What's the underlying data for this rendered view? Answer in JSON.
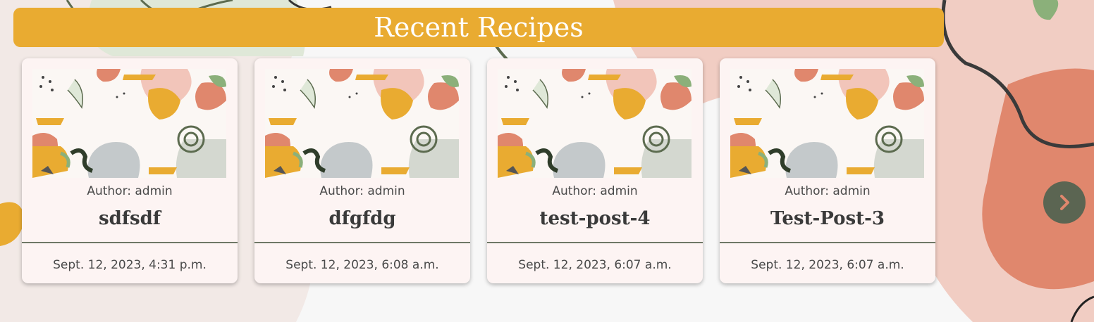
{
  "section": {
    "title": "Recent Recipes"
  },
  "recipes": [
    {
      "author": "Author: admin",
      "title": "sdfsdf",
      "date": "Sept. 12, 2023, 4:31 p.m."
    },
    {
      "author": "Author: admin",
      "title": "dfgfdg",
      "date": "Sept. 12, 2023, 6:08 a.m."
    },
    {
      "author": "Author: admin",
      "title": "test-post-4",
      "date": "Sept. 12, 2023, 6:07 a.m."
    },
    {
      "author": "Author: admin",
      "title": "Test-Post-3",
      "date": "Sept. 12, 2023, 6:07 a.m."
    }
  ],
  "carousel": {
    "next_icon": "chevron-right-icon"
  },
  "colors": {
    "banner": "#e9ab31",
    "card_bg": "#fdf4f3",
    "divider": "#6e7866",
    "next_button": "#5b6552",
    "accent_salmon": "#e0876d",
    "accent_pink": "#f0c8bd",
    "accent_green": "#d7e3cf"
  }
}
